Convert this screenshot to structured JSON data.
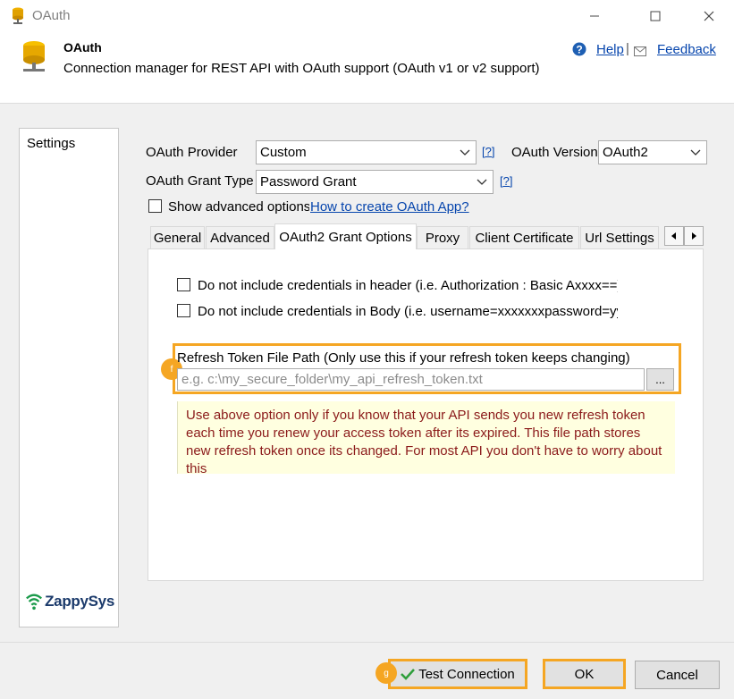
{
  "window": {
    "title": "OAuth",
    "controls": [
      "minimize",
      "maximize",
      "close"
    ]
  },
  "header": {
    "title": "OAuth",
    "description": "Connection manager for REST API with OAuth support (OAuth v1 or v2 support)",
    "help_label": "Help",
    "feedback_label": "Feedback",
    "separator": "|"
  },
  "sidebar": {
    "items": [
      {
        "label": "Settings"
      }
    ],
    "logo_text": "ZappySys"
  },
  "form": {
    "provider_label": "OAuth Provider",
    "provider_value": "Custom",
    "provider_help": "[?]",
    "version_label": "OAuth Version",
    "version_value": "OAuth2",
    "grant_label": "OAuth Grant Type",
    "grant_value": "Password Grant",
    "grant_help": "[?]",
    "advanced_checkbox_label": "Show advanced options",
    "advanced_checked": false,
    "create_app_link": "How to create OAuth App?"
  },
  "tabs": [
    {
      "label": "General"
    },
    {
      "label": "Advanced"
    },
    {
      "label": "OAuth2 Grant Options",
      "active": true
    },
    {
      "label": "Proxy"
    },
    {
      "label": "Client Certificate"
    },
    {
      "label": "Url Settings"
    }
  ],
  "tab_content": {
    "no_cred_header_label": "Do not include credentials in header (i.e. Authorization : Basic Axxxx==)",
    "no_cred_header_checked": false,
    "no_cred_body_label": "Do not include credentials in Body (i.e. username=xxxxxxxpassword=yy",
    "no_cred_body_checked": false,
    "refresh_token_label": "Refresh Token File Path (Only use this if your refresh token keeps changing)",
    "refresh_token_value": "",
    "refresh_token_placeholder": "e.g. c:\\my_secure_folder\\my_api_refresh_token.txt",
    "browse_label": "...",
    "note": "Use above option only if you know that your API sends you new refresh token each time you renew your access token after its expired. This file path stores new refresh token once its changed. For most API you don't have to worry about this",
    "badge_f": "f"
  },
  "footer": {
    "test_connection_label": "Test Connection",
    "ok_label": "OK",
    "cancel_label": "Cancel",
    "badge_g": "g"
  },
  "colors": {
    "highlight": "#f5a623",
    "link": "#0645ad",
    "note_bg": "#ffffe0",
    "note_text": "#8b1a1a"
  }
}
